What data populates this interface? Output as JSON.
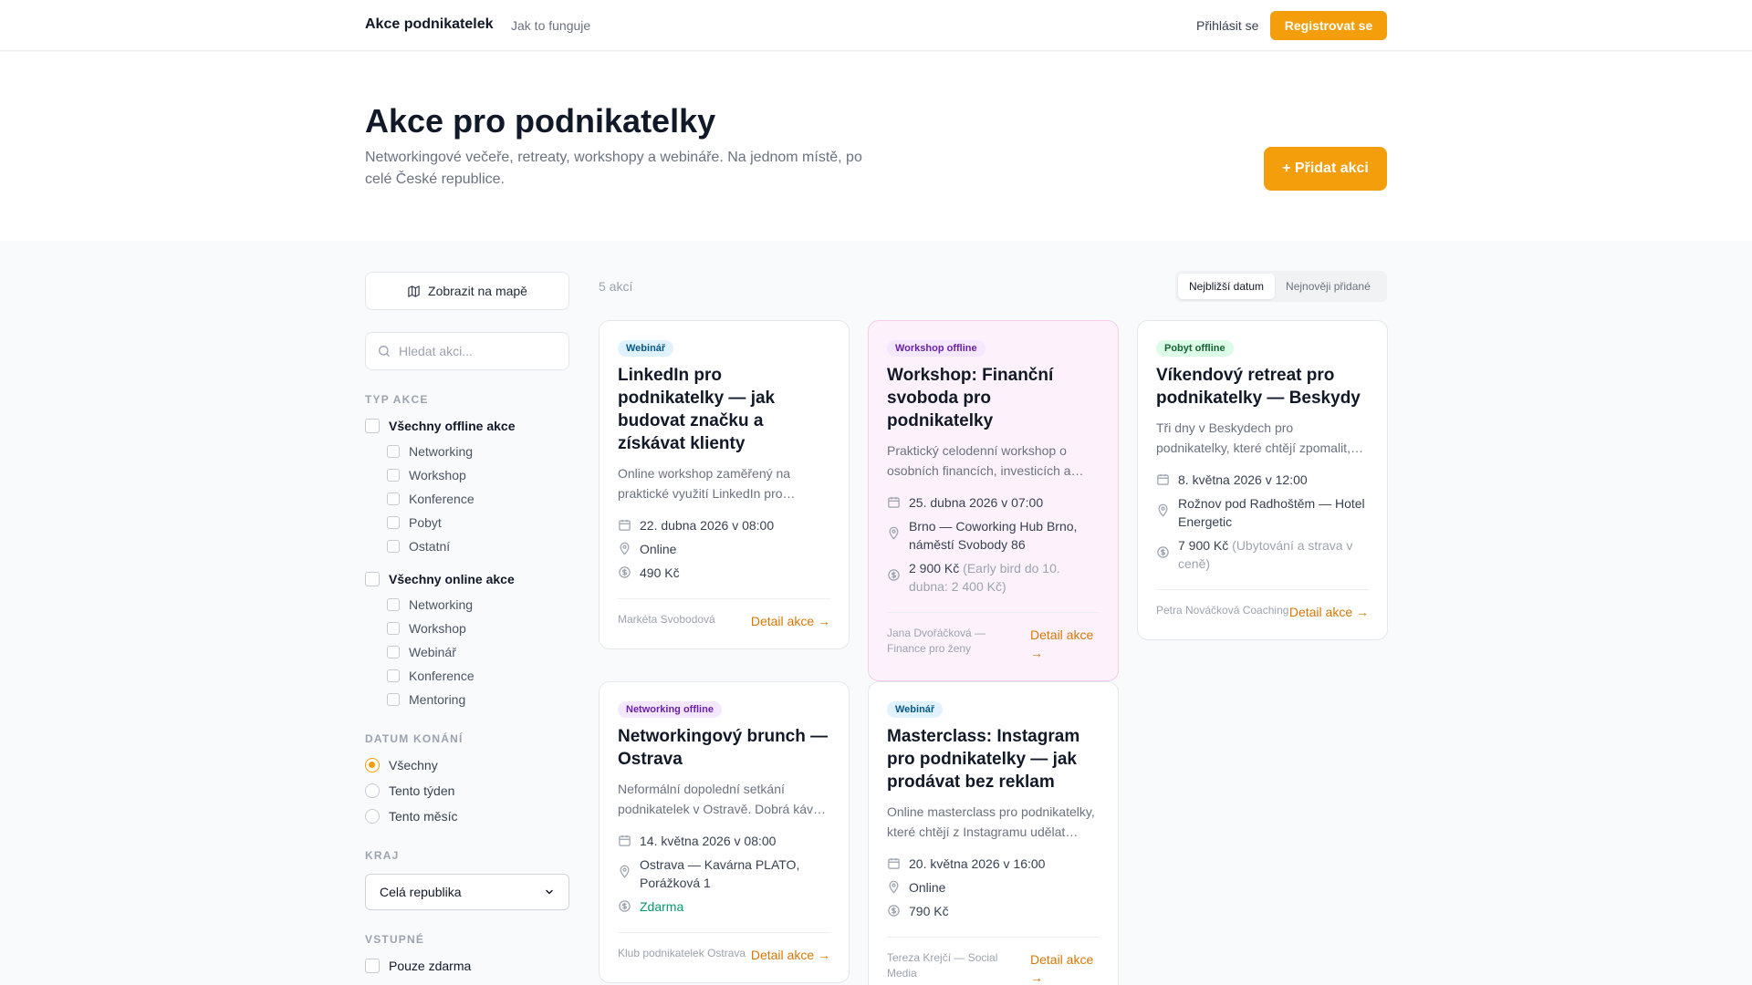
{
  "header": {
    "brand": "Akce podnikatelek",
    "nav_howto": "Jak to funguje",
    "login": "Přihlásit se",
    "register": "Registrovat se"
  },
  "hero": {
    "title": "Akce pro podnikatelky",
    "subtitle": "Networkingové večeře, retreaty, workshopy a webináře. Na jednom místě, po celé České republice.",
    "add_button": "+ Přidat akci"
  },
  "sidebar": {
    "map_button": "Zobrazit na mapě",
    "search_placeholder": "Hledat akci...",
    "type_title": "TYP AKCE",
    "offline_all": "Všechny offline akce",
    "offline_items": [
      "Networking",
      "Workshop",
      "Konference",
      "Pobyt",
      "Ostatní"
    ],
    "online_all": "Všechny online akce",
    "online_items": [
      "Networking",
      "Workshop",
      "Webinář",
      "Konference",
      "Mentoring"
    ],
    "date_title": "DATUM KONÁNÍ",
    "date_options": [
      "Všechny",
      "Tento týden",
      "Tento měsíc"
    ],
    "date_selected": "Všechny",
    "region_title": "KRAJ",
    "region_value": "Celá republika",
    "price_title": "VSTUPNÉ",
    "price_free": "Pouze zdarma"
  },
  "results": {
    "count": "5 akcí",
    "sort_options": [
      "Nejbližší datum",
      "Nejnověji přidané"
    ],
    "sort_active": "Nejbližší datum",
    "detail_label": "Detail akce →"
  },
  "events": [
    {
      "badge": "Webinář",
      "title": "LinkedIn pro podnikatelky — jak budovat značku a získávat klienty",
      "desc": "Online workshop zaměřený na praktické využití LinkedIn pro…",
      "date": "22. dubna 2026 v 08:00",
      "location": "Online",
      "price": "490 Kč",
      "price_note": "",
      "organizer": "Markéta Svobodová"
    },
    {
      "badge": "Workshop offline",
      "title": "Workshop: Finanční svoboda pro podnikatelky",
      "desc": "Praktický celodenní workshop o osobních financích, investicích a…",
      "date": "25. dubna 2026 v 07:00",
      "location": "Brno — Coworking Hub Brno, náměstí Svobody 86",
      "price": "2 900 Kč",
      "price_note": "(Early bird do 10. dubna: 2 400 Kč)",
      "organizer": "Jana Dvořáčková — Finance pro ženy"
    },
    {
      "badge": "Pobyt offline",
      "title": "Víkendový retreat pro podnikatelky — Beskydy",
      "desc": "Tři dny v Beskydech pro podnikatelky, které chtějí zpomalit,…",
      "date": "8. května 2026 v 12:00",
      "location": "Rožnov pod Radhoštěm — Hotel Energetic",
      "price": "7 900 Kč",
      "price_note": "(Ubytování a strava v ceně)",
      "organizer": "Petra Nováčková Coaching"
    },
    {
      "badge": "Networking offline",
      "title": "Networkingový brunch — Ostrava",
      "desc": "Neformální dopolední setkání podnikatelek v Ostravě. Dobrá káv…",
      "date": "14. května 2026 v 08:00",
      "location": "Ostrava — Kavárna PLATO, Porážková 1",
      "price": "Zdarma",
      "price_note": "",
      "organizer": "Klub podnikatelek Ostrava"
    },
    {
      "badge": "Webinář",
      "title": "Masterclass: Instagram pro podnikatelky — jak prodávat bez reklam",
      "desc": "Online masterclass pro podnikatelky, které chtějí z Instagramu udělat…",
      "date": "20. května 2026 v 16:00",
      "location": "Online",
      "price": "790 Kč",
      "price_note": "",
      "organizer": "Tereza Krejčí — Social Media"
    }
  ]
}
